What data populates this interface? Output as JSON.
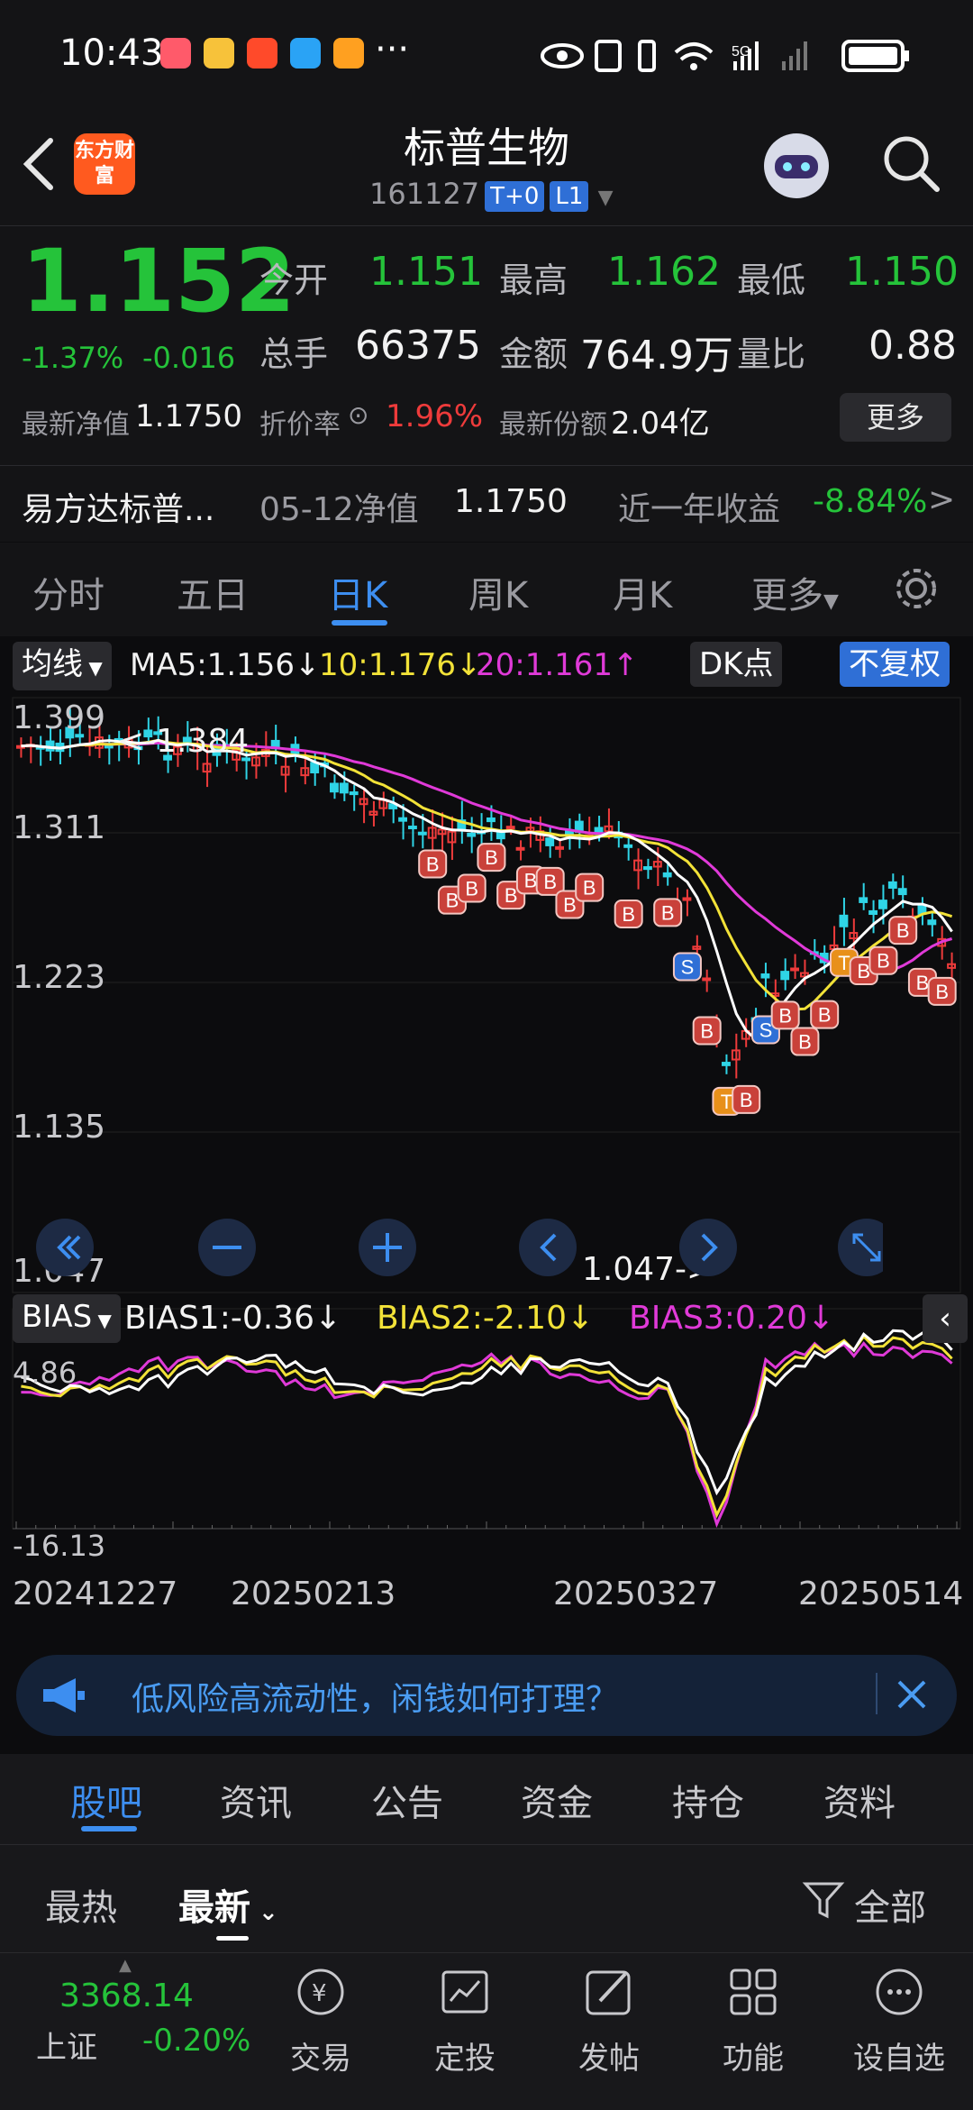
{
  "status": {
    "time": "10:43",
    "more": "···",
    "network": "5G"
  },
  "header": {
    "title": "标普生物",
    "code": "161127",
    "tag_t0": "T+0",
    "tag_l1": "L1",
    "logo_text": "东方财富"
  },
  "quote": {
    "price": "1.152",
    "change_pct": "-1.37%",
    "change": "-0.016",
    "open_label": "今开",
    "open": "1.151",
    "high_label": "最高",
    "high": "1.162",
    "low_label": "最低",
    "low": "1.150",
    "volume_label": "总手",
    "volume": "66375",
    "amount_label": "金额",
    "amount": "764.9万",
    "ratio_label": "量比",
    "ratio": "0.88",
    "nav_label": "最新净值",
    "nav": "1.1750",
    "discount_label": "折价率",
    "discount": "1.96%",
    "shares_label": "最新份额",
    "shares": "2.04亿",
    "more": "更多"
  },
  "fund": {
    "name": "易方达标普...",
    "nav_date_label": "05-12净值",
    "nav_value": "1.1750",
    "yearly_label": "近一年收益",
    "yearly_value": "-8.84%",
    "arrow": ">"
  },
  "ktabs": [
    "分时",
    "五日",
    "日K",
    "周K",
    "月K",
    "更多"
  ],
  "ktabs_active": "日K",
  "chart": {
    "ma_selector": "均线",
    "ma5": "MA5:1.156↓",
    "ma10": "10:1.176↓",
    "ma20": "20:1.161↑",
    "dk": "DK点",
    "restore": "不复权",
    "y_labels": [
      "1.399",
      "1.311",
      "1.223",
      "1.135",
      "1.047"
    ],
    "high_note": "<-1.384",
    "low_note": "1.047->",
    "bias_selector": "BIAS",
    "bias1": "BIAS1:-0.36↓",
    "bias2": "BIAS2:-2.10↓",
    "bias3": "BIAS3:0.20↓",
    "bias_top": "4.86",
    "bias_bottom": "-16.13",
    "dates": [
      "20241227",
      "20250213",
      "20250327",
      "20250514"
    ],
    "colors": {
      "ma5": "#ffffff",
      "ma10": "#f2e238",
      "ma20": "#e03ad8",
      "up": "#ee3b3b",
      "down": "#2fd4e6"
    }
  },
  "chart_data": {
    "type": "candlestick",
    "y_range": [
      1.047,
      1.399
    ],
    "bias_range": [
      -16.13,
      4.86
    ],
    "x_start": "20241227",
    "x_end": "20250514"
  },
  "banner": {
    "text": "低风险高流动性，闲钱如何打理？"
  },
  "subtabs": [
    "股吧",
    "资讯",
    "公告",
    "资金",
    "持仓",
    "资料"
  ],
  "subtabs_active": "股吧",
  "sort": {
    "hot": "最热",
    "new": "最新",
    "filter": "全部"
  },
  "bottom": {
    "index_value": "3368.14",
    "index_name": "上证",
    "index_change": "-0.20%",
    "nav": [
      "交易",
      "定投",
      "发帖",
      "功能",
      "设自选"
    ]
  }
}
